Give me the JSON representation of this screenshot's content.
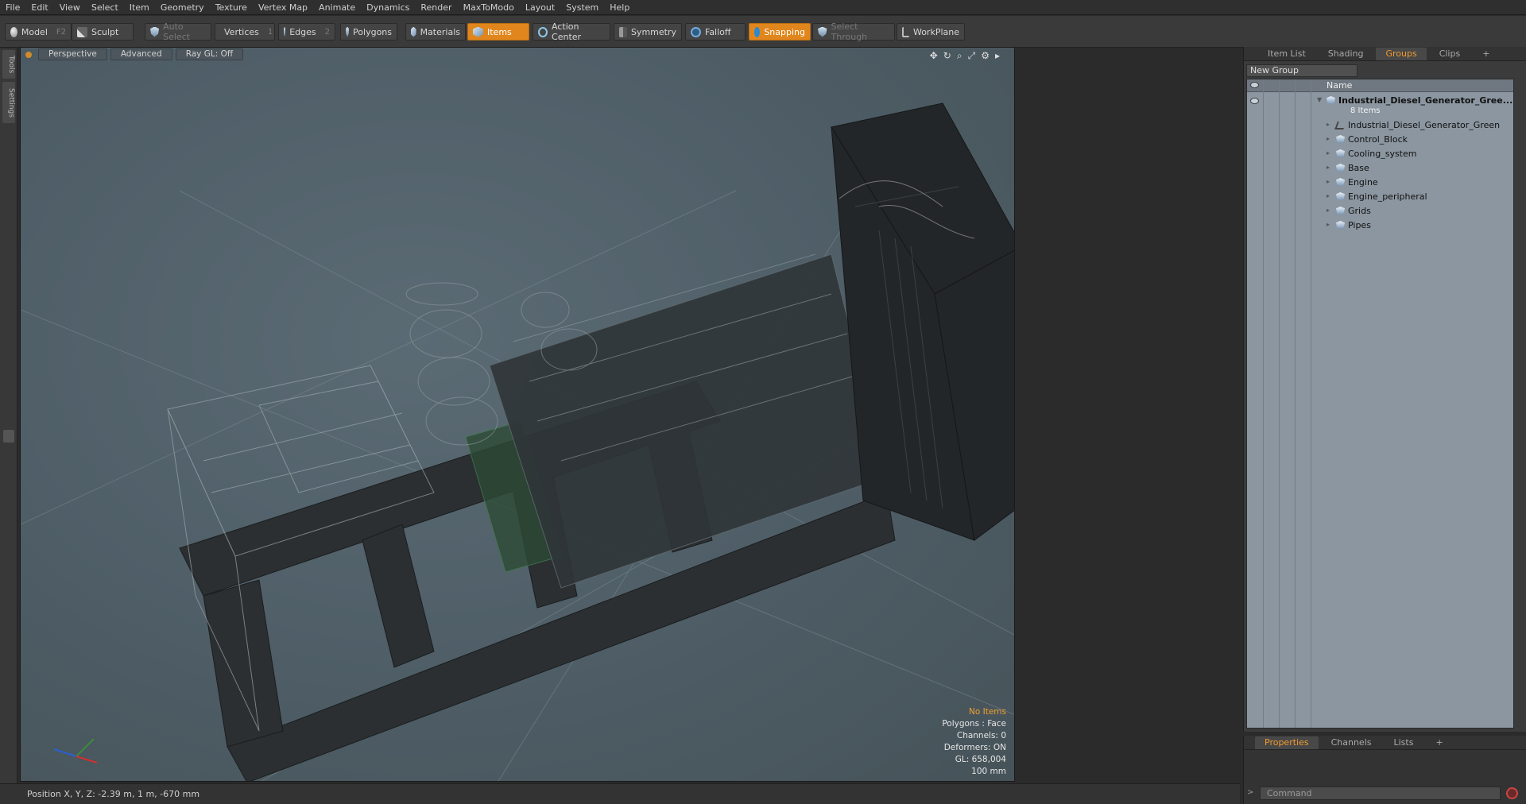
{
  "menu": [
    "File",
    "Edit",
    "View",
    "Select",
    "Item",
    "Geometry",
    "Texture",
    "Vertex Map",
    "Animate",
    "Dynamics",
    "Render",
    "MaxToModo",
    "Layout",
    "System",
    "Help"
  ],
  "toolbar": {
    "model": "Model",
    "model_key": "F2",
    "sculpt": "Sculpt",
    "auto_select": "Auto Select",
    "vertices": "Vertices",
    "vertices_key": "1",
    "edges": "Edges",
    "edges_key": "2",
    "polygons": "Polygons",
    "materials": "Materials",
    "items": "Items",
    "action_center": "Action Center",
    "symmetry": "Symmetry",
    "falloff": "Falloff",
    "snapping": "Snapping",
    "select_through": "Select Through",
    "workplane": "WorkPlane",
    "accent": "#e0861c"
  },
  "left_tabs": [
    "Tools",
    "Settings"
  ],
  "viewport": {
    "view": "Perspective",
    "mode": "Advanced",
    "raygl": "Ray GL: Off",
    "hud": {
      "selection": "No Items",
      "polygons": "Polygons : Face",
      "channels": "Channels: 0",
      "deformers": "Deformers: ON",
      "gl": "GL: 658,004",
      "scale": "100 mm"
    }
  },
  "status": {
    "position": "Position X, Y, Z:  -2.39 m, 1 m, -670 mm"
  },
  "right_panel": {
    "tabs": [
      "Item List",
      "Shading",
      "Groups",
      "Clips",
      "+"
    ],
    "active_tab": "Groups",
    "new_group": "New Group",
    "name_header": "Name",
    "root": {
      "name": "Industrial_Diesel_Generator_Gree...",
      "count": "8 Items"
    },
    "children": [
      "Industrial_Diesel_Generator_Green",
      "Control_Block",
      "Cooling_system",
      "Base",
      "Engine",
      "Engine_peripheral",
      "Grids",
      "Pipes"
    ]
  },
  "bottom_panel": {
    "tabs": [
      "Properties",
      "Channels",
      "Lists",
      "+"
    ],
    "command_placeholder": "Command"
  }
}
